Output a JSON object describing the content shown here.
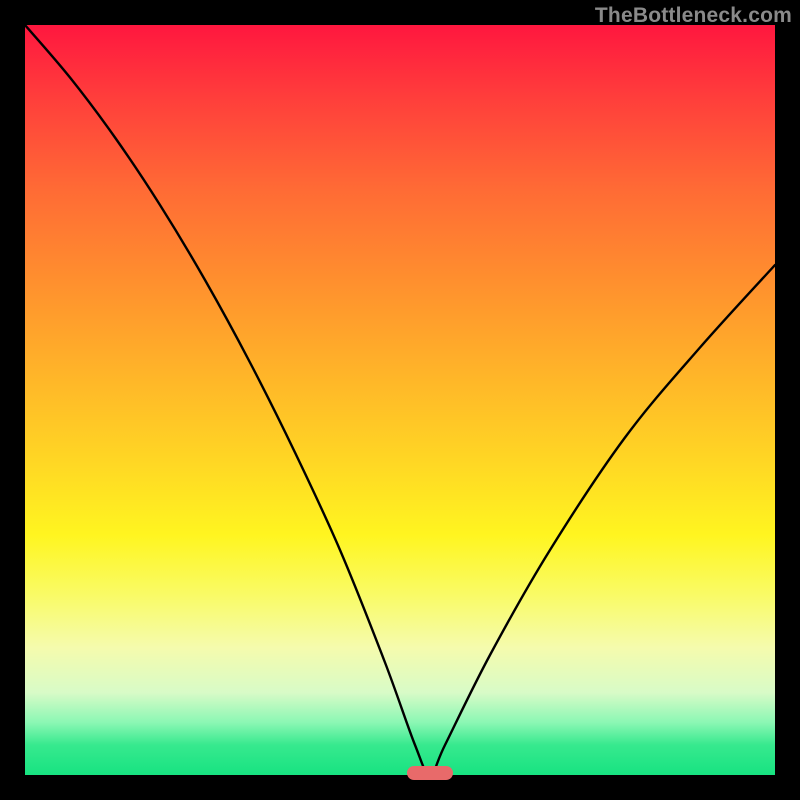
{
  "watermark": {
    "text": "TheBottleneck.com"
  },
  "chart_data": {
    "type": "line",
    "title": "",
    "xlabel": "",
    "ylabel": "",
    "xlim": [
      0,
      100
    ],
    "ylim": [
      0,
      100
    ],
    "min_point": {
      "x": 54,
      "y": 0
    },
    "series": [
      {
        "name": "bottleneck-curve",
        "x": [
          0,
          6,
          12,
          18,
          24,
          30,
          36,
          42,
          48,
          52,
          54,
          56,
          62,
          70,
          80,
          90,
          100
        ],
        "values": [
          100,
          93,
          85,
          76,
          66,
          55,
          43,
          30,
          15,
          4,
          0,
          4,
          16,
          30,
          45,
          57,
          68
        ]
      }
    ],
    "gradient_stops": [
      {
        "pct": 0,
        "color": "#ff173f"
      },
      {
        "pct": 10,
        "color": "#ff3f3b"
      },
      {
        "pct": 22,
        "color": "#ff6b35"
      },
      {
        "pct": 34,
        "color": "#ff8f2e"
      },
      {
        "pct": 46,
        "color": "#ffb329"
      },
      {
        "pct": 58,
        "color": "#ffd624"
      },
      {
        "pct": 68,
        "color": "#fff520"
      },
      {
        "pct": 76,
        "color": "#f9fb66"
      },
      {
        "pct": 83,
        "color": "#f5fbad"
      },
      {
        "pct": 89,
        "color": "#d8fbc7"
      },
      {
        "pct": 93,
        "color": "#8bf7b4"
      },
      {
        "pct": 96,
        "color": "#37e98e"
      },
      {
        "pct": 100,
        "color": "#17e381"
      }
    ],
    "marker": {
      "x": 54,
      "y": 0,
      "color": "#e86a6a"
    }
  }
}
